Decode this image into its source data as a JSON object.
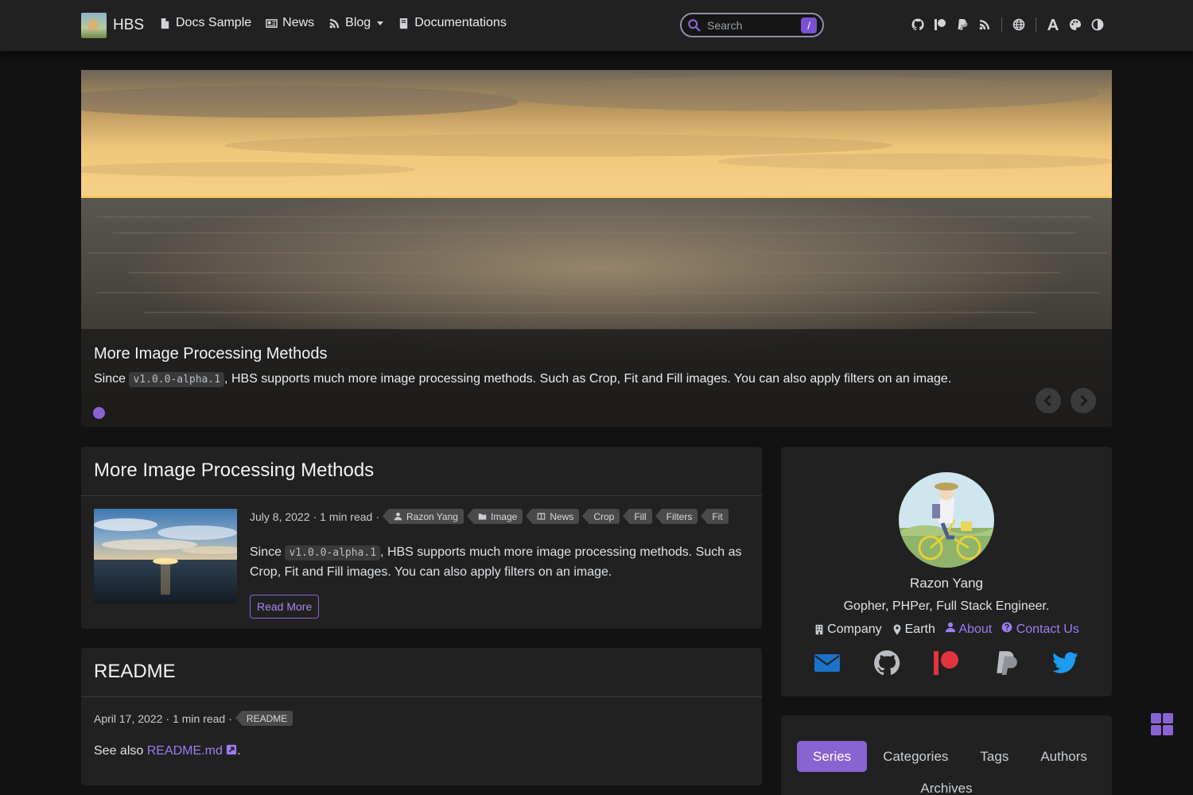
{
  "nav": {
    "brand": "HBS",
    "links": [
      {
        "label": "Docs Sample",
        "icon": "file-icon"
      },
      {
        "label": "News",
        "icon": "newspaper-icon"
      },
      {
        "label": "Blog",
        "icon": "blog-icon"
      },
      {
        "label": "Documentations",
        "icon": "book-icon"
      }
    ],
    "search_placeholder": "Search",
    "search_shortcut": "/",
    "right_icons": [
      "github-icon",
      "patreon-icon",
      "paypal-icon",
      "rss-icon",
      "globe-icon",
      "font-size-icon",
      "palette-icon",
      "contrast-icon"
    ]
  },
  "hero": {
    "title": "More Image Processing Methods",
    "desc_before": "Since ",
    "desc_code": "v1.0.0-alpha.1",
    "desc_after": ", HBS supports much more image processing methods. Such as Crop, Fit and Fill images. You can also apply filters on an image."
  },
  "post": {
    "title": "More Image Processing Methods",
    "date": "July 8, 2022",
    "read_time": "1 min read",
    "author": "Razon Yang",
    "categories": [
      "Image",
      "News"
    ],
    "tags": [
      "Crop",
      "Fill",
      "Filters",
      "Fit"
    ],
    "desc_before": "Since ",
    "desc_code": "v1.0.0-alpha.1",
    "desc_after": ", HBS supports much more image processing methods. Such as Crop, Fit and Fill images. You can also apply filters on an image.",
    "read_more": "Read More"
  },
  "readme": {
    "title": "README",
    "date": "April 17, 2022",
    "read_time": "1 min read",
    "tag": "README",
    "see_also_prefix": "See also ",
    "link": "README.md",
    "suffix": "."
  },
  "profile": {
    "name": "Razon Yang",
    "bio": "Gopher, PHPer, Full Stack Engineer.",
    "company": "Company",
    "location": "Earth",
    "about": "About",
    "contact": "Contact Us",
    "socials": [
      {
        "icon": "envelope-icon",
        "color": "#1a73c8"
      },
      {
        "icon": "github-icon",
        "color": "#b9bdc1"
      },
      {
        "icon": "patreon-icon",
        "color": "#e0343f"
      },
      {
        "icon": "paypal-icon",
        "color": "#b9bdc1"
      },
      {
        "icon": "twitter-icon",
        "color": "#1d9bf0"
      }
    ]
  },
  "sidebar_tabs": {
    "items": [
      "Series",
      "Categories",
      "Tags",
      "Authors"
    ],
    "active": "Series",
    "archives": "Archives"
  },
  "colors": {
    "accent": "#8a63d2",
    "background": "#121212",
    "card": "#212121"
  }
}
